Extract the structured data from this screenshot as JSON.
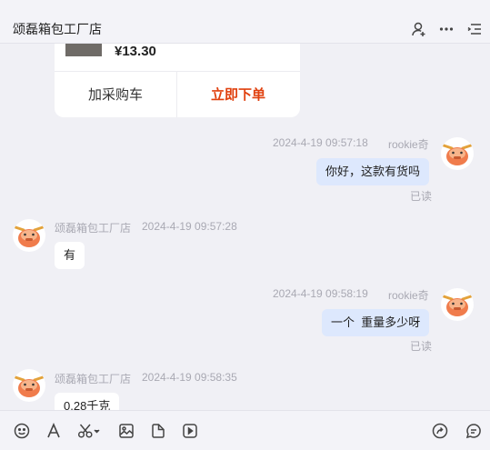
{
  "header": {
    "title": "颂磊箱包工厂店",
    "icons": [
      "add-user-icon",
      "more-icon",
      "menu-icon"
    ]
  },
  "product_card": {
    "price": "¥13.30",
    "add_to_cart_label": "加采购车",
    "buy_now_label": "立即下单",
    "buy_color": "#e0410f"
  },
  "messages": [
    {
      "sender": "rookie奇",
      "time": "2024-4-19 09:57:18",
      "text": "你好，这款有货吗",
      "status": "已读"
    },
    {
      "sender": "颂磊箱包工厂店",
      "time": "2024-4-19 09:57:28",
      "text": "有"
    },
    {
      "sender": "rookie奇",
      "time": "2024-4-19 09:58:19",
      "text": "一个  重量多少呀",
      "status": "已读"
    },
    {
      "sender": "颂磊箱包工厂店",
      "time": "2024-4-19 09:58:35",
      "text": "0.28千克"
    }
  ],
  "toolbar": {
    "icons": [
      "emoji-icon",
      "font-icon",
      "scissors-icon",
      "image-icon",
      "file-icon",
      "video-icon",
      "share-icon",
      "quick-reply-icon"
    ]
  },
  "colors": {
    "my_bubble": "#dde8fd",
    "background": "#f0f0f5",
    "avatar_face": "#f07c4c"
  }
}
